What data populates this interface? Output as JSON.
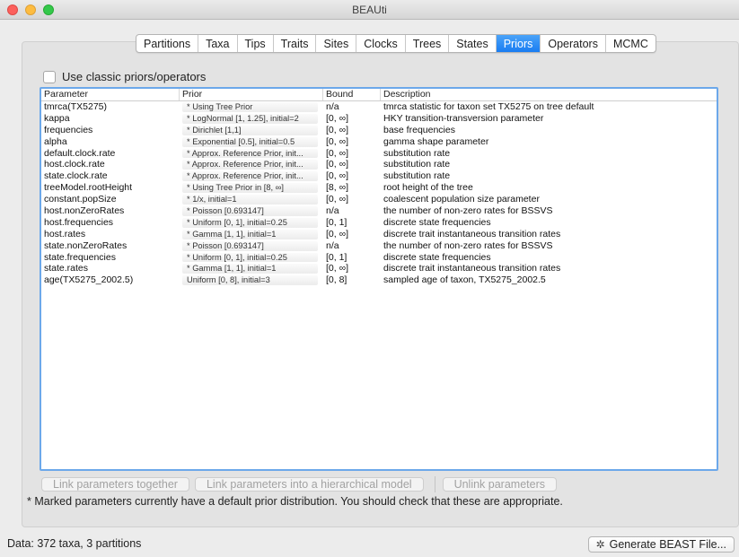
{
  "window": {
    "title": "BEAUti"
  },
  "tabs": [
    "Partitions",
    "Taxa",
    "Tips",
    "Traits",
    "Sites",
    "Clocks",
    "Trees",
    "States",
    "Priors",
    "Operators",
    "MCMC"
  ],
  "selected_tab": "Priors",
  "classic_checkbox": {
    "label": "Use classic priors/operators",
    "checked": false
  },
  "table": {
    "headers": [
      "Parameter",
      "Prior",
      "Bound",
      "Description"
    ],
    "rows": [
      [
        "tmrca(TX5275)",
        "* Using Tree Prior",
        "n/a",
        "tmrca statistic for taxon set TX5275 on tree default"
      ],
      [
        "kappa",
        "* LogNormal [1, 1.25], initial=2",
        "[0, ∞]",
        "HKY transition-transversion parameter"
      ],
      [
        "frequencies",
        "* Dirichlet [1,1]",
        "[0, ∞]",
        "base frequencies"
      ],
      [
        "alpha",
        "* Exponential [0.5], initial=0.5",
        "[0, ∞]",
        "gamma shape parameter"
      ],
      [
        "default.clock.rate",
        "* Approx. Reference Prior, init...",
        "[0, ∞]",
        "substitution rate"
      ],
      [
        "host.clock.rate",
        "* Approx. Reference Prior, init...",
        "[0, ∞]",
        "substitution rate"
      ],
      [
        "state.clock.rate",
        "* Approx. Reference Prior, init...",
        "[0, ∞]",
        "substitution rate"
      ],
      [
        "treeModel.rootHeight",
        "* Using Tree Prior in [8, ∞]",
        "[8, ∞]",
        "root height of the tree"
      ],
      [
        "constant.popSize",
        "* 1/x, initial=1",
        "[0, ∞]",
        "coalescent population size parameter"
      ],
      [
        "host.nonZeroRates",
        "* Poisson [0.693147]",
        "n/a",
        "the number of non-zero rates for BSSVS"
      ],
      [
        "host.frequencies",
        "* Uniform [0, 1], initial=0.25",
        "[0, 1]",
        "discrete state frequencies"
      ],
      [
        "host.rates",
        "* Gamma [1, 1], initial=1",
        "[0, ∞]",
        "discrete trait instantaneous transition rates"
      ],
      [
        "state.nonZeroRates",
        "* Poisson [0.693147]",
        "n/a",
        "the number of non-zero rates for BSSVS"
      ],
      [
        "state.frequencies",
        "* Uniform [0, 1], initial=0.25",
        "[0, 1]",
        "discrete state frequencies"
      ],
      [
        "state.rates",
        "* Gamma [1, 1], initial=1",
        "[0, ∞]",
        "discrete trait instantaneous transition rates"
      ],
      [
        "age(TX5275_2002.5)",
        "Uniform [0, 8], initial=3",
        "[0, 8]",
        "sampled age of taxon, TX5275_2002.5"
      ]
    ]
  },
  "buttons": {
    "link": "Link parameters together",
    "link_hier": "Link parameters into a hierarchical model",
    "unlink": "Unlink parameters"
  },
  "note": "* Marked parameters currently have a default prior distribution. You should check that these are appropriate.",
  "status": {
    "text": "Data: 372 taxa, 3 partitions",
    "generate": "Generate BEAST File..."
  },
  "icons": {
    "generate": "gear-icon"
  },
  "colors": {
    "selected_tab": "#1a7df2",
    "table_focus_border": "#6ca8ea"
  }
}
